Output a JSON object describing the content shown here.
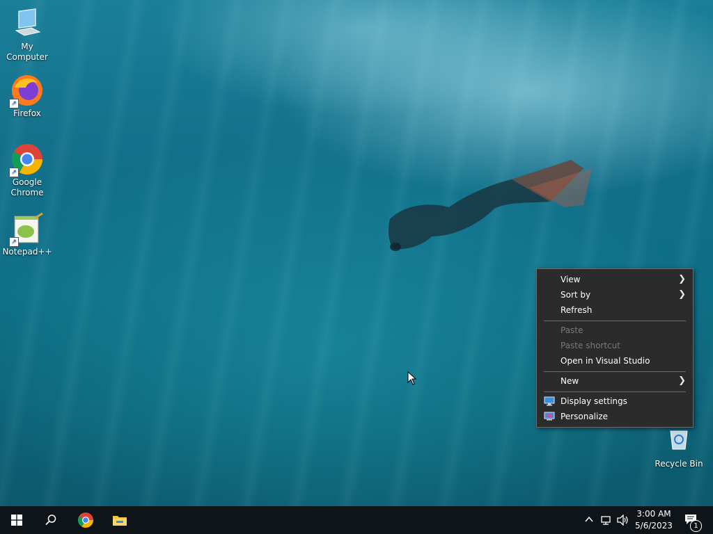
{
  "desktop": {
    "icons": [
      {
        "label": "My Computer",
        "icon": "computer-icon"
      },
      {
        "label": "Firefox",
        "icon": "firefox-icon"
      },
      {
        "label": "Google Chrome",
        "icon": "chrome-icon"
      },
      {
        "label": "Notepad++",
        "icon": "notepadpp-icon"
      },
      {
        "label": "Recycle Bin",
        "icon": "recycle-bin-icon"
      }
    ]
  },
  "context_menu": {
    "items": [
      {
        "label": "View",
        "submenu": true
      },
      {
        "label": "Sort by",
        "submenu": true
      },
      {
        "label": "Refresh"
      },
      {
        "label": "Paste",
        "disabled": true
      },
      {
        "label": "Paste shortcut",
        "disabled": true
      },
      {
        "label": "Open in Visual Studio"
      },
      {
        "label": "New",
        "submenu": true
      },
      {
        "label": "Display settings",
        "icon": "display-icon"
      },
      {
        "label": "Personalize",
        "icon": "personalize-icon"
      }
    ]
  },
  "taskbar": {
    "start_icon": "windows-icon",
    "search_icon": "search-icon",
    "pinned": [
      "chrome-icon",
      "file-explorer-icon"
    ],
    "clock_time": "3:00 AM",
    "clock_date": "5/6/2023",
    "notification_count": "1"
  },
  "colors": {
    "menu_bg": "#2b2b2b",
    "taskbar_bg": "#0f1418",
    "disabled_text": "#7a7a7a"
  }
}
